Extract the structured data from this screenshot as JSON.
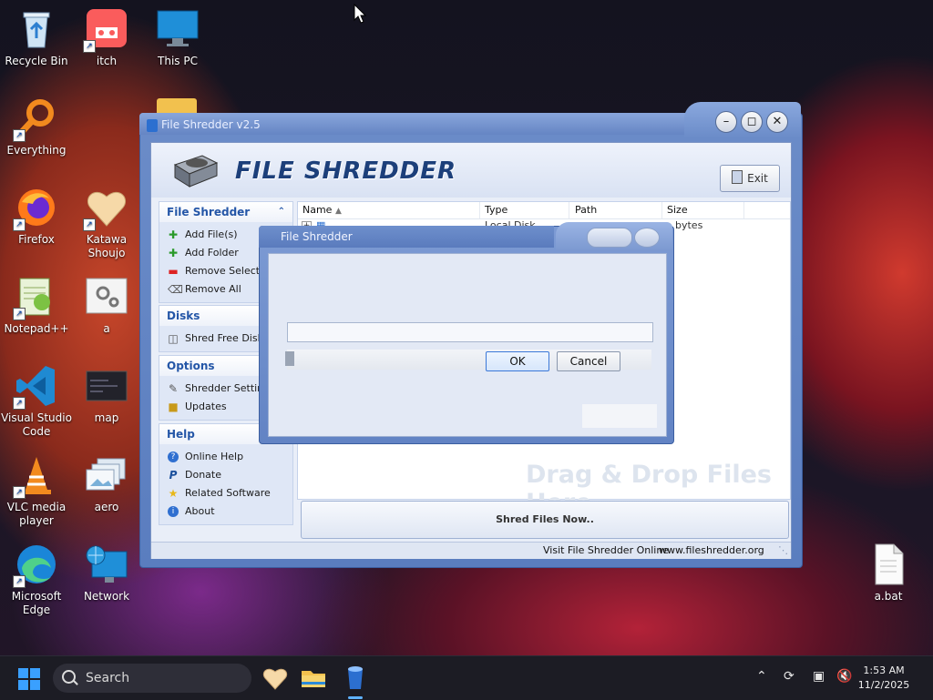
{
  "desktop": {
    "icons": [
      {
        "label": "Recycle Bin"
      },
      {
        "label": "itch"
      },
      {
        "label": "This PC"
      },
      {
        "label": "Everything"
      },
      {
        "label": "Firefox"
      },
      {
        "label": "Katawa Shoujo"
      },
      {
        "label": "Notepad++"
      },
      {
        "label": "a"
      },
      {
        "label": "Visual Studio Code"
      },
      {
        "label": "map"
      },
      {
        "label": "VLC media player"
      },
      {
        "label": "aero"
      },
      {
        "label": "Microsoft Edge"
      },
      {
        "label": "Network"
      },
      {
        "label": "a.bat"
      }
    ]
  },
  "app": {
    "window_title": "File Shredder v2.5",
    "banner_title": "FILE SHREDDER",
    "exit_label": "Exit",
    "sections": [
      {
        "title": "File Shredder",
        "items": [
          {
            "label": "Add File(s)",
            "icon": "plus-icon"
          },
          {
            "label": "Add Folder",
            "icon": "plus-icon"
          },
          {
            "label": "Remove Selected",
            "icon": "minus-icon"
          },
          {
            "label": "Remove All",
            "icon": "eraser-icon"
          }
        ]
      },
      {
        "title": "Disks",
        "items": [
          {
            "label": "Shred Free Disk Space",
            "icon": "disk-icon"
          }
        ]
      },
      {
        "title": "Options",
        "items": [
          {
            "label": "Shredder Settings",
            "icon": "settings-icon"
          },
          {
            "label": "Updates",
            "icon": "updates-icon"
          }
        ]
      },
      {
        "title": "Help",
        "items": [
          {
            "label": "Online Help",
            "icon": "help-icon"
          },
          {
            "label": "Donate",
            "icon": "paypal-icon"
          },
          {
            "label": "Related Software",
            "icon": "star-icon"
          },
          {
            "label": "About",
            "icon": "about-icon"
          }
        ]
      }
    ],
    "columns": [
      "Name",
      "Type",
      "Path",
      "Size"
    ],
    "row": {
      "type": "Local Disk",
      "size": "bytes"
    },
    "drag_drop": "Drag & Drop Files Here",
    "shred_button": "Shred Files Now..",
    "status_left": "Visit File Shredder Online",
    "status_right": "www.fileshredder.org"
  },
  "dialog": {
    "title": "File Shredder",
    "input_value": "",
    "ok_label": "OK",
    "cancel_label": "Cancel"
  },
  "taskbar": {
    "search_placeholder": "Search",
    "time": "1:53 AM",
    "date": "11/2/2025"
  },
  "colors": {
    "accent": "#2456a7",
    "window_frame": "#6b8cc8",
    "taskbar": "#1c1c24"
  }
}
